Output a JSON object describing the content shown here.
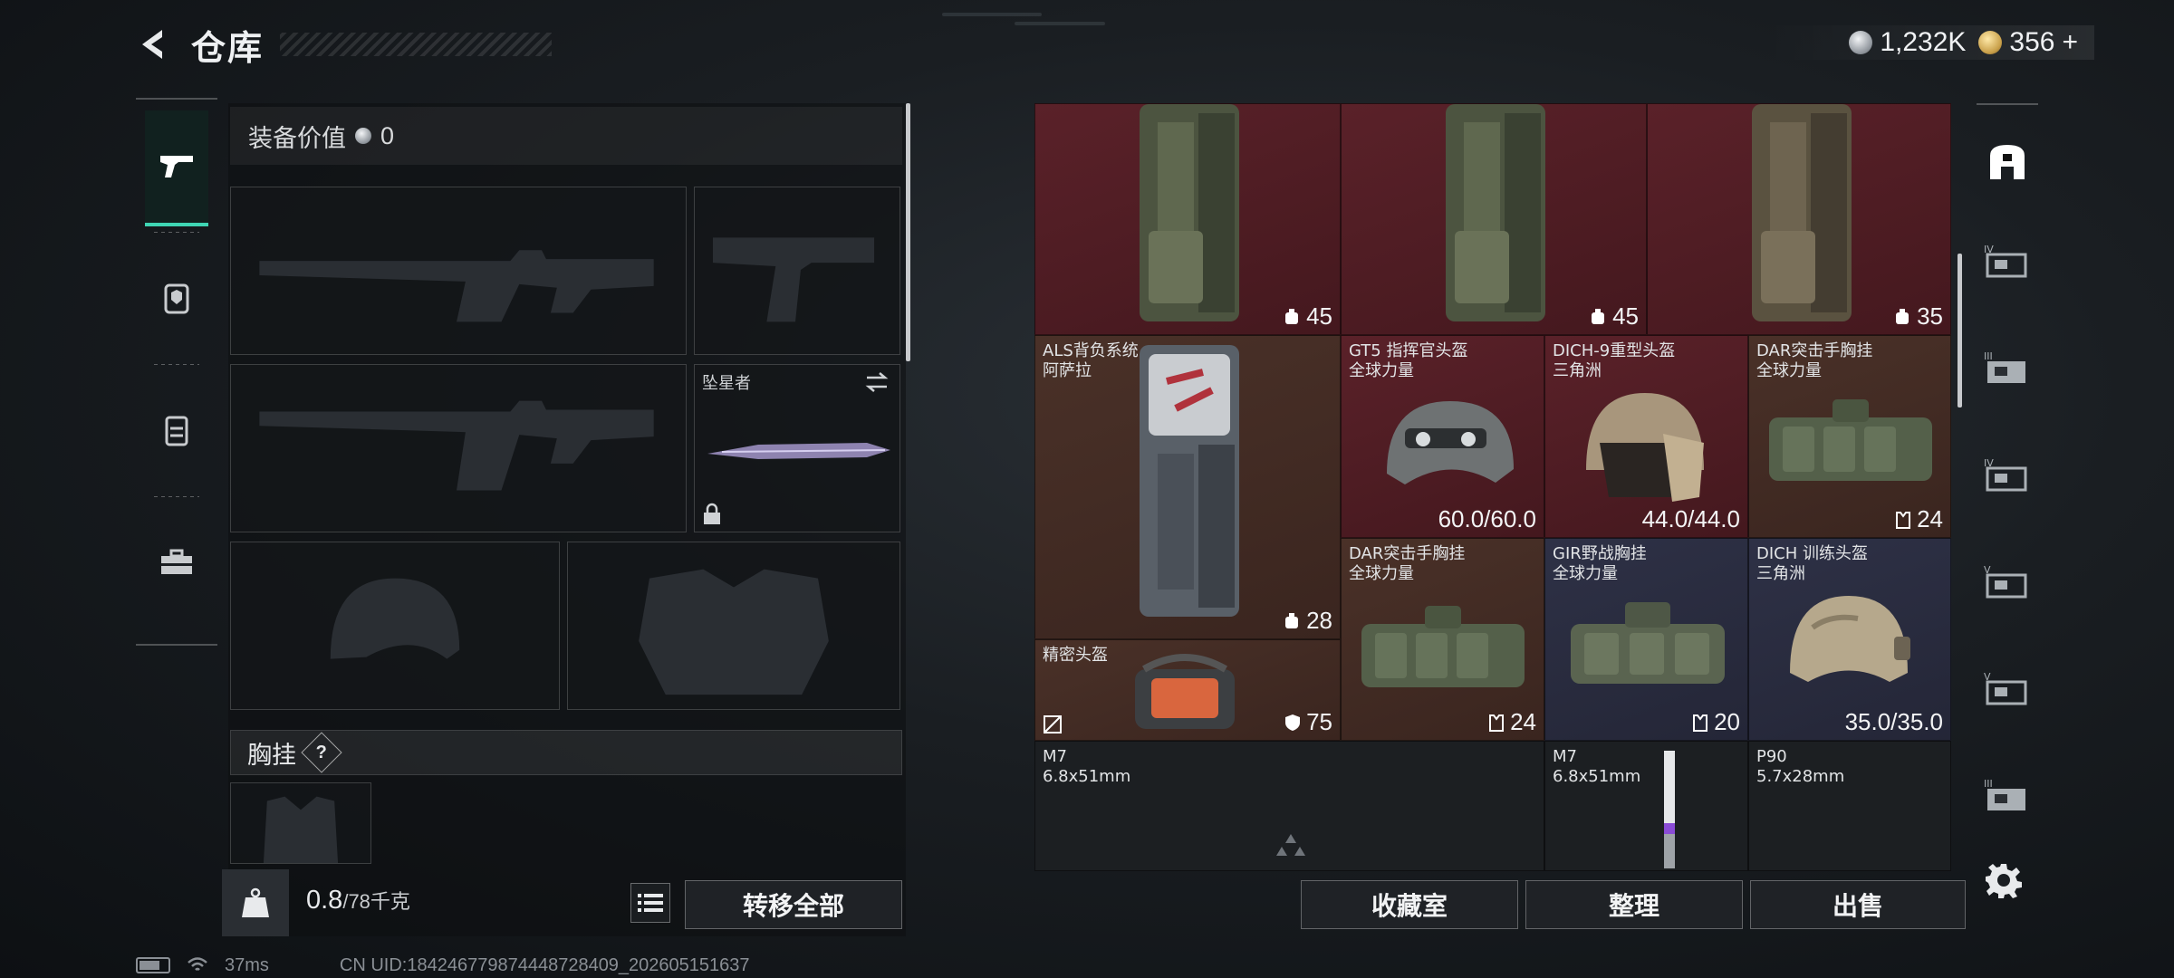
{
  "header": {
    "title": "仓库"
  },
  "currency": {
    "silver": "1,232K",
    "gold": "356",
    "gold_plus": "+"
  },
  "left_rail": [
    {
      "name": "weapons",
      "icon": "pistol-icon"
    },
    {
      "name": "armor",
      "icon": "backpack-shield-icon"
    },
    {
      "name": "backpack",
      "icon": "backpack-icon"
    },
    {
      "name": "supplies",
      "icon": "toolbox-icon"
    }
  ],
  "loadout": {
    "equip_value_label": "装备价值",
    "equip_value": "0",
    "melee_label": "坠星者",
    "chest_rig_label": "胸挂",
    "chest_rig_help": "?"
  },
  "weight": {
    "current": "0.8",
    "max": "/78千克"
  },
  "actions": {
    "transfer_all": "转移全部",
    "collection": "收藏室",
    "organize": "整理",
    "sell": "出售"
  },
  "stash_items": [
    {
      "id": "bp1",
      "name": "",
      "sub": "",
      "stat": "45"
    },
    {
      "id": "bp2",
      "name": "",
      "sub": "",
      "stat": "45"
    },
    {
      "id": "bp3",
      "name": "",
      "sub": "",
      "stat": "35"
    },
    {
      "id": "als",
      "name": "ALS背负系统",
      "sub": "阿萨拉",
      "stat": "28"
    },
    {
      "id": "gt5",
      "name": "GT5 指挥官头盔",
      "sub": "全球力量",
      "stat": "60.0/60.0"
    },
    {
      "id": "dich9",
      "name": "DICH-9重型头盔",
      "sub": "三角洲",
      "stat": "44.0/44.0"
    },
    {
      "id": "dar1",
      "name": "DAR突击手胸挂",
      "sub": "全球力量",
      "stat": "24"
    },
    {
      "id": "dar2",
      "name": "DAR突击手胸挂",
      "sub": "全球力量",
      "stat": "24"
    },
    {
      "id": "gir",
      "name": "GIR野战胸挂",
      "sub": "全球力量",
      "stat": "20"
    },
    {
      "id": "dich",
      "name": "DICH 训练头盔",
      "sub": "三角洲",
      "stat": "35.0/35.0"
    },
    {
      "id": "precise",
      "name": "精密头盔",
      "sub": "",
      "stat": "75"
    },
    {
      "id": "m7a",
      "name": "M7",
      "sub": "6.8x51mm",
      "stat": ""
    },
    {
      "id": "m7b",
      "name": "M7",
      "sub": "6.8x51mm",
      "stat": ""
    },
    {
      "id": "p90",
      "name": "P90",
      "sub": "5.7x28mm",
      "stat": ""
    }
  ],
  "right_rail": [
    {
      "name": "container",
      "icon": "safe-box-icon"
    },
    {
      "name": "tier-iv",
      "icon": "tier-iv-case-icon"
    },
    {
      "name": "tier-iii",
      "icon": "tier-iii-case-icon"
    },
    {
      "name": "tier-iv-2",
      "icon": "tier-iv-case-icon"
    },
    {
      "name": "tier-v",
      "icon": "tier-v-case-icon"
    },
    {
      "name": "tier-v-2",
      "icon": "tier-v-case-icon"
    },
    {
      "name": "tier-iii-2",
      "icon": "tier-iii-case-icon"
    }
  ],
  "status": {
    "ping": "37ms",
    "uid": "CN UID:18424677987444872840​9_202605151637"
  }
}
